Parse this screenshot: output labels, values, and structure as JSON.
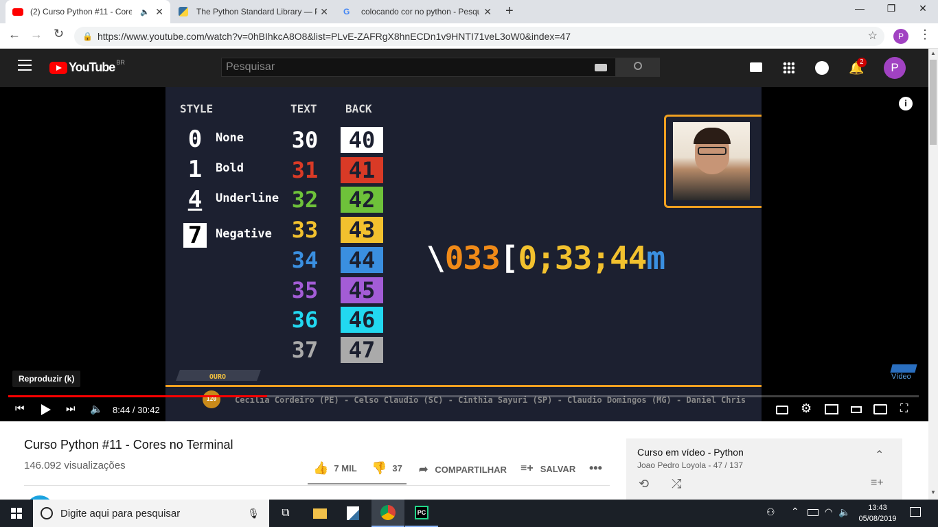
{
  "browser": {
    "tabs": [
      {
        "title": "(2) Curso Python #11 - Cores no Terminal"
      },
      {
        "title": "The Python Standard Library — Python"
      },
      {
        "title": "colocando cor no python - Pesquisa Google"
      }
    ],
    "url": "https://www.youtube.com/watch?v=0hBIhkcA8O8&list=PLvE-ZAFRgX8hnECDn1v9HNTI71veL3oW0&index=47",
    "profile_initial": "P"
  },
  "youtube": {
    "logo_text": "YouTube",
    "region": "BR",
    "search_placeholder": "Pesquisar",
    "notif_count": "2",
    "avatar_initial": "P"
  },
  "video": {
    "style_header": "STYLE",
    "text_header": "TEXT",
    "back_header": "BACK",
    "styles": [
      {
        "code": "0",
        "name": "None"
      },
      {
        "code": "1",
        "name": "Bold"
      },
      {
        "code": "4",
        "name": "Underline"
      },
      {
        "code": "7",
        "name": "Negative"
      }
    ],
    "text_codes": [
      "30",
      "31",
      "32",
      "33",
      "34",
      "35",
      "36",
      "37"
    ],
    "back_codes": [
      "40",
      "41",
      "42",
      "43",
      "44",
      "45",
      "46",
      "47"
    ],
    "code_colors": [
      "#ffffff",
      "#d93a26",
      "#6ec23a",
      "#f2c12e",
      "#3a8fe0",
      "#a35cd6",
      "#22d8f0",
      "#aaaaaa"
    ],
    "escape_parts": [
      "\\",
      "033",
      "[",
      "0;33;44",
      "m"
    ],
    "badge": "OURO",
    "coin": "120",
    "ticker": "Cecilia Cordeiro (PE) - Celso Claudio (SC) - Cinthia Sayuri (SP) - Claudio Domingos (MG) - Daniel Chris",
    "watermark": "Vídeo"
  },
  "player": {
    "tooltip": "Reproduzir (k)",
    "time": "8:44 / 30:42",
    "progress": 0.284
  },
  "meta": {
    "title": "Curso Python #11 - Cores no Terminal",
    "views": "146.092 visualizações",
    "likes": "7 MIL",
    "dislikes": "37",
    "share": "COMPARTILHAR",
    "save": "SALVAR"
  },
  "playlist": {
    "title": "Curso em vídeo - Python",
    "subtitle": "Joao Pedro Loyola - 47 / 137"
  },
  "taskbar": {
    "search": "Digite aqui para pesquisar",
    "time": "13:43",
    "date": "05/08/2019"
  }
}
